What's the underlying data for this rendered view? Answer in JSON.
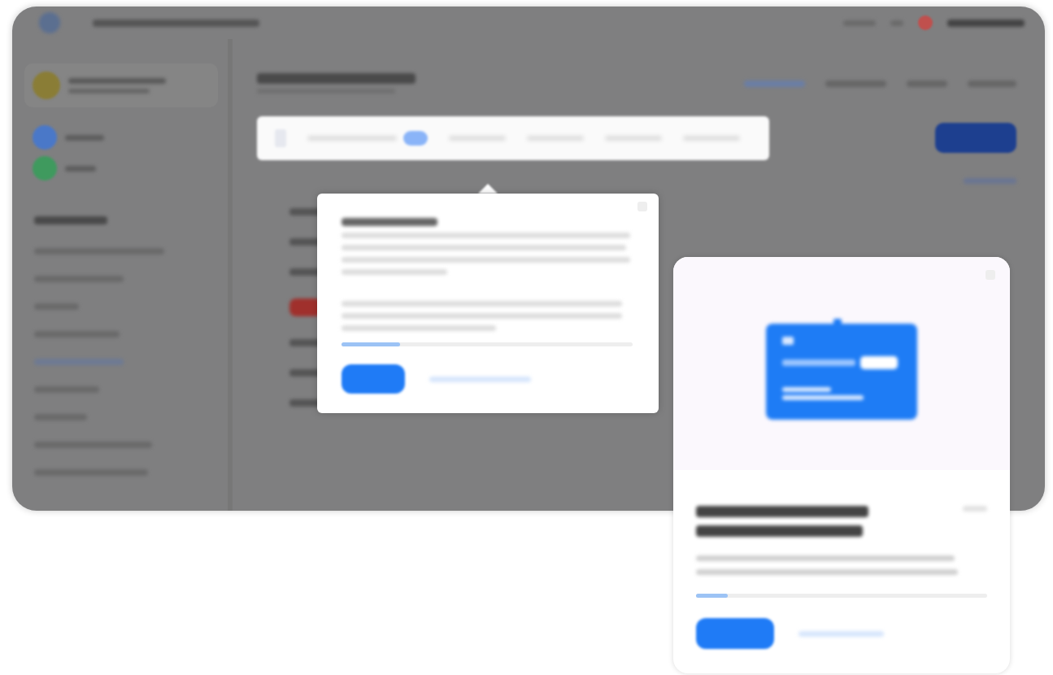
{
  "app_window": {
    "header": {
      "user_avatar": {
        "color": "#c0504d"
      }
    },
    "sidebar": {
      "shortcuts": [
        {
          "color": "#4a78c8"
        },
        {
          "color": "#3f9a5e"
        }
      ],
      "items": [
        {
          "selected": false
        },
        {
          "selected": false
        },
        {
          "selected": false
        },
        {
          "selected": false
        },
        {
          "selected": true
        },
        {
          "selected": false
        },
        {
          "selected": false
        },
        {
          "selected": false
        },
        {
          "selected": false
        }
      ]
    },
    "tabs": [
      {
        "selected": true
      },
      {
        "selected": false
      },
      {
        "selected": false
      },
      {
        "selected": false
      }
    ],
    "toolbar": {
      "segments": [
        {
          "selected": true
        },
        {
          "selected": false
        },
        {
          "selected": false
        },
        {
          "selected": false
        },
        {
          "selected": false
        }
      ]
    },
    "rows": [
      {
        "kind": "text"
      },
      {
        "kind": "text"
      },
      {
        "kind": "text"
      },
      {
        "kind": "tag",
        "color": "#a0302c"
      },
      {
        "kind": "text"
      },
      {
        "kind": "text"
      },
      {
        "kind": "text"
      }
    ]
  },
  "tour_popover": {
    "progress": {
      "level": 0.2
    }
  },
  "welcome_card": {
    "progress": {
      "level": 0.11
    }
  }
}
